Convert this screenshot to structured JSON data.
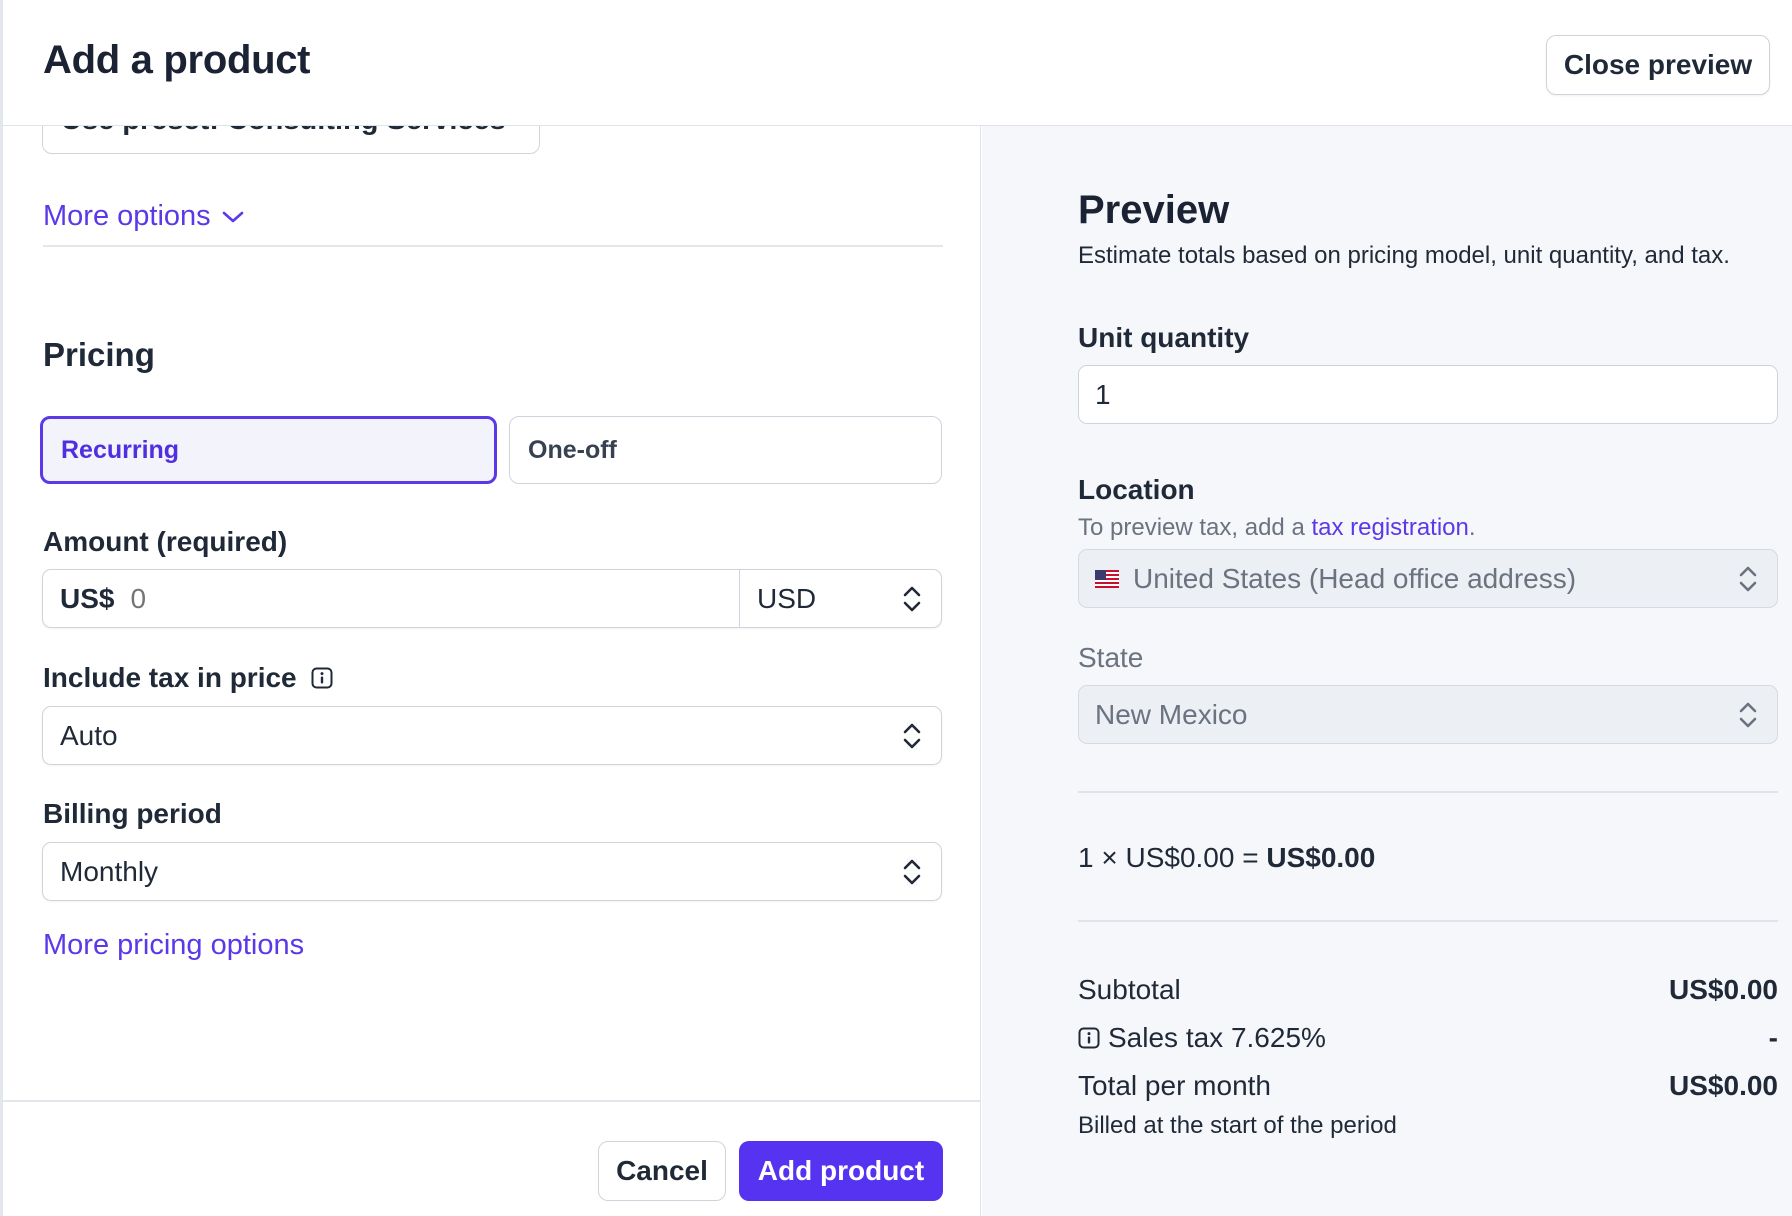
{
  "header": {
    "title": "Add a product",
    "close_preview_label": "Close preview"
  },
  "left": {
    "preset_label": "Use preset: Consulting Services",
    "more_options_label": "More options",
    "pricing_title": "Pricing",
    "pricing_types": [
      {
        "label": "Recurring",
        "selected": true
      },
      {
        "label": "One-off",
        "selected": false
      }
    ],
    "amount": {
      "label": "Amount (required)",
      "prefix": "US$",
      "placeholder": "0",
      "currency": "USD"
    },
    "include_tax": {
      "label": "Include tax in price",
      "value": "Auto"
    },
    "billing_period": {
      "label": "Billing period",
      "value": "Monthly"
    },
    "more_pricing_label": "More pricing options",
    "cancel_label": "Cancel",
    "add_product_label": "Add product"
  },
  "preview": {
    "title": "Preview",
    "subtitle": "Estimate totals based on pricing model, unit quantity, and tax.",
    "unit_quantity_label": "Unit quantity",
    "unit_quantity_value": "1",
    "location_label": "Location",
    "location_hint_prefix": "To preview tax, add a ",
    "location_hint_link": "tax registration",
    "location_hint_suffix": ".",
    "location_value": "United States (Head office address)",
    "state_label": "State",
    "state_value": "New Mexico",
    "calc_text": "1 × US$0.00 = ",
    "calc_result": "US$0.00",
    "subtotal_label": "Subtotal",
    "subtotal_value": "US$0.00",
    "sales_tax_label": "Sales tax 7.625%",
    "sales_tax_value": "-",
    "total_label": "Total per month",
    "total_value": "US$0.00",
    "billed_note": "Billed at the start of the period"
  },
  "colors": {
    "accent": "#5533f0",
    "link": "#5b39e8",
    "preview_bg": "#f5f7fa"
  }
}
